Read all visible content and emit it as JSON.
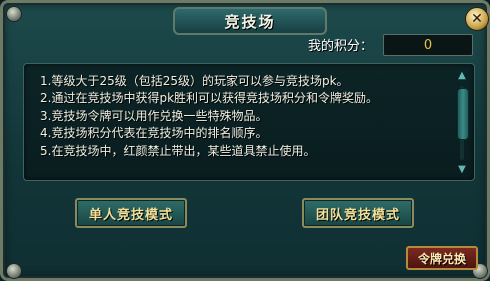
{
  "window": {
    "title": "竞技场",
    "close_glyph": "✕"
  },
  "score": {
    "label": "我的积分：",
    "value": "0"
  },
  "rules": [
    "1.等级大于25级（包括25级）的玩家可以参与竞技场pk。",
    "2.通过在竞技场中获得pk胜利可以获得竞技场积分和令牌奖励。",
    "3.竞技场令牌可以用作兑换一些特殊物品。",
    "4.竞技场积分代表在竞技场中的排名顺序。",
    "5.在竞技场中，红颜禁止带出，某些道具禁止使用。"
  ],
  "buttons": {
    "single_mode": "单人竞技模式",
    "team_mode": "团队竞技模式",
    "redeem": "令牌兑换"
  },
  "icons": {
    "close": "close-icon",
    "scroll_up": "chevron-up-icon",
    "scroll_down": "chevron-down-icon"
  },
  "colors": {
    "panel": "#123538",
    "title_text": "#f2f5e6",
    "button_text": "#f1e19a",
    "score_text": "#e8c050",
    "redeem_bg": "#7a2a20"
  }
}
